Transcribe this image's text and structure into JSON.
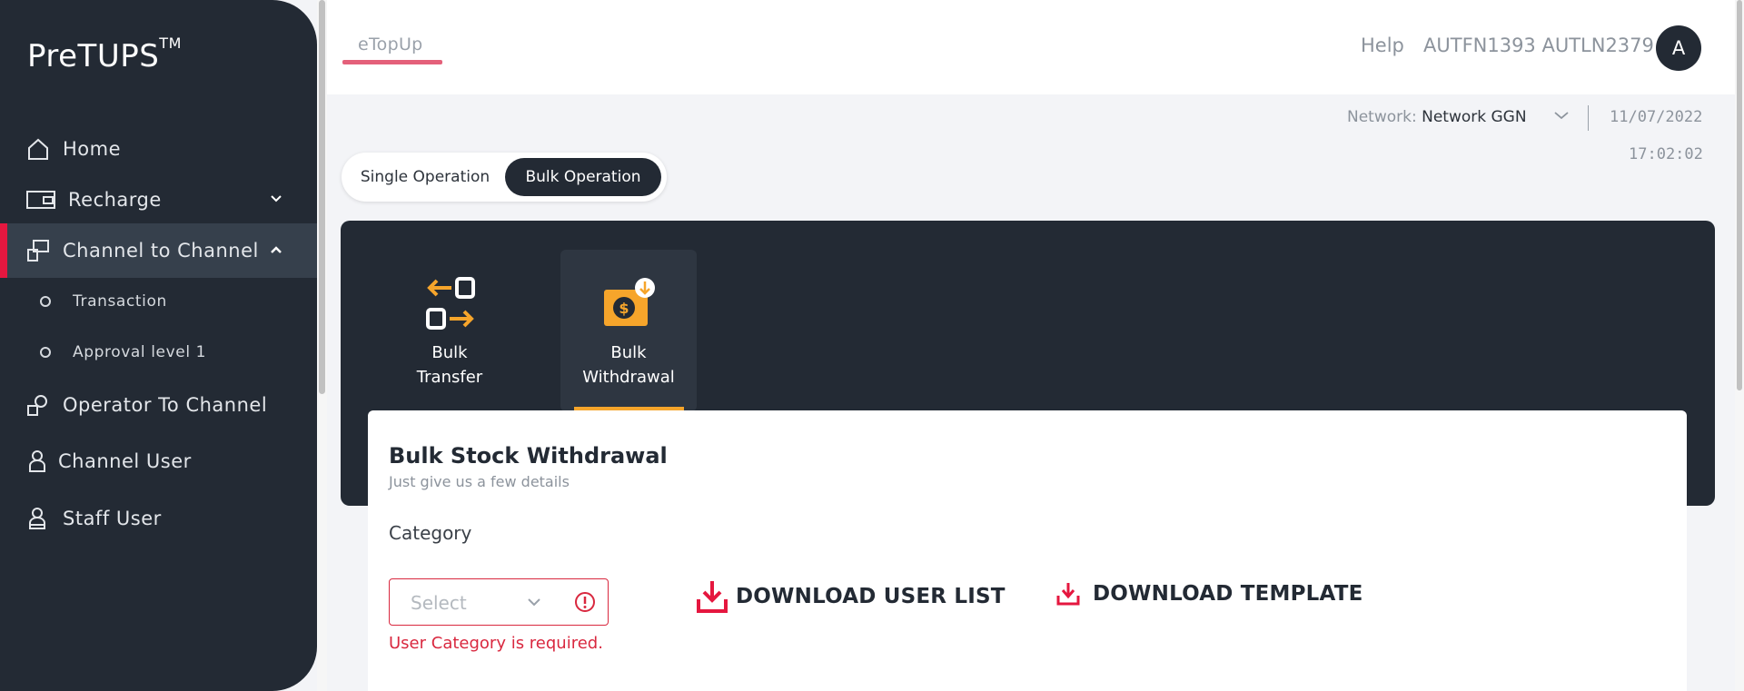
{
  "brand": {
    "name": "PreTUPS",
    "trademark": "TM"
  },
  "sidebar": {
    "items": [
      {
        "label": "Home",
        "icon": "home-icon"
      },
      {
        "label": "Recharge",
        "icon": "recharge-icon"
      },
      {
        "label": "Channel to Channel",
        "icon": "channel-transfer-icon"
      },
      {
        "label": "Operator To Channel",
        "icon": "operator-channel-icon"
      },
      {
        "label": "Channel User",
        "icon": "user-icon"
      },
      {
        "label": "Staff User",
        "icon": "staff-user-icon"
      }
    ],
    "sub_items": [
      {
        "label": "Transaction"
      },
      {
        "label": "Approval level 1"
      }
    ]
  },
  "header": {
    "tab": "eTopUp",
    "help": "Help",
    "username": "AUTFN1393 AUTLN2379",
    "avatar_initial": "A"
  },
  "network": {
    "label": "Network:",
    "value": "Network GGN",
    "date": "11/07/2022",
    "time": "17:02:02"
  },
  "operation_toggle": {
    "single": "Single Operation",
    "bulk": "Bulk Operation",
    "selected": "Bulk Operation"
  },
  "tiles": [
    {
      "line1": "Bulk",
      "line2": "Transfer",
      "icon": "bulk-transfer-icon"
    },
    {
      "line1": "Bulk",
      "line2": "Withdrawal",
      "icon": "bulk-withdrawal-icon"
    }
  ],
  "form": {
    "title": "Bulk Stock Withdrawal",
    "subtitle": "Just give us a few details",
    "category_label": "Category",
    "category_placeholder": "Select",
    "error": "User Category is required.",
    "download_user_list": "DOWNLOAD USER LIST",
    "download_template": "DOWNLOAD TEMPLATE"
  },
  "colors": {
    "sidebar": "#232a34",
    "accent_red": "#e5173f",
    "accent_orange": "#f6a52b",
    "error": "#d9283f"
  }
}
